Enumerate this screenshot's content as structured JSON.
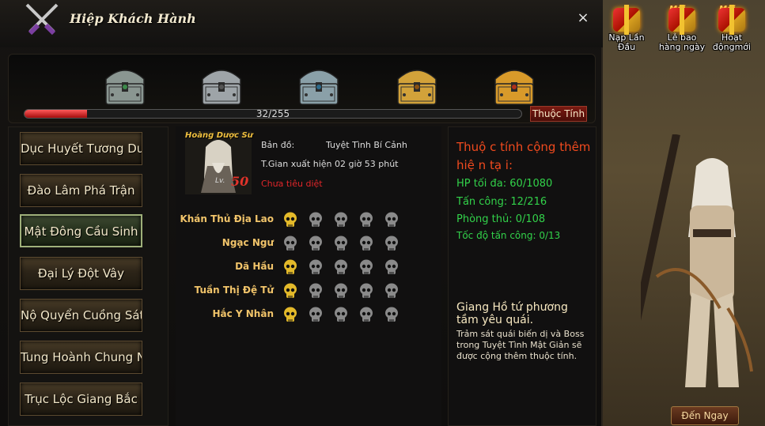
{
  "window": {
    "title": "Hiệp Khách Hành",
    "close_label": "×"
  },
  "hud": {
    "icons": [
      {
        "name": "nap-lan-dau",
        "badge": "",
        "label": "Nạp Lần Đầu"
      },
      {
        "name": "le-bao-hang-ngay",
        "badge": "Mới",
        "label": "Lễ bao hàng ngày"
      },
      {
        "name": "hoat-dong-moi",
        "badge": "Mới",
        "label": "Hoạt độngmới"
      }
    ],
    "go_button": "Đến Ngay"
  },
  "chests": [
    {
      "type": "silver-green"
    },
    {
      "type": "silver"
    },
    {
      "type": "silver-blue"
    },
    {
      "type": "gold"
    },
    {
      "type": "gold-red"
    }
  ],
  "progress": {
    "current": 32,
    "max": 255,
    "text": "32/255"
  },
  "attribute_button": "Thuộc Tính",
  "menu": [
    {
      "label": "Dục Huyết Tương Dương",
      "active": false
    },
    {
      "label": "Đào Lâm Phá Trận",
      "active": false
    },
    {
      "label": "Mật Đông Cầu Sinh",
      "active": true
    },
    {
      "label": "Đại Lý Đột Vây",
      "active": false
    },
    {
      "label": "Nộ Quyển Cuồng Sát",
      "active": false
    },
    {
      "label": "Tung Hoành Chung Nam",
      "active": false
    },
    {
      "label": "Trục Lộc Giang Bắc",
      "active": false
    }
  ],
  "boss": {
    "name": "Hoàng Dược Sư",
    "level_prefix": "Lv.",
    "level": "50",
    "map_label": "Bản đồ:",
    "map_value": "Tuyệt Tình Bí Cảnh",
    "appear_time": "T.Gian xuất hiện 02 giờ 53 phút",
    "status": "Chưa tiêu diệt"
  },
  "boss_list": [
    {
      "name": "Khán Thủ Địa Lao",
      "skulls": [
        1,
        0,
        0,
        0,
        0
      ]
    },
    {
      "name": "Ngạc Ngư",
      "skulls": [
        0,
        0,
        0,
        0,
        0
      ]
    },
    {
      "name": "Dã Hầu",
      "skulls": [
        1,
        0,
        0,
        0,
        0
      ]
    },
    {
      "name": "Tuần Thị Đệ Tử",
      "skulls": [
        1,
        0,
        0,
        0,
        0
      ]
    },
    {
      "name": "Hắc Y Nhân",
      "skulls": [
        1,
        0,
        0,
        0,
        0
      ]
    }
  ],
  "attributes": {
    "title": "Thuộ c tính cộng thêm hiệ n tạ i:",
    "hp": "HP tối đa: 60/1080",
    "attack": "Tấn công: 12/216",
    "defense": "Phòng thủ: 0/108",
    "speed": "Tốc độ   tấn công: 0/13"
  },
  "quest": {
    "title": "Giang Hồ tứ phương tầm yêu quái.",
    "description": "Trảm sát quái biến dị và Boss trong Tuyệt Tình Mật Giản sẽ được cộng thêm thuộc tính."
  },
  "colors": {
    "skull_gold": "#e3b92a",
    "skull_grey": "#8a8a8a",
    "attr_title": "#f04a1e",
    "attr_value": "#32d24a",
    "boss_name": "#f1c46a"
  }
}
